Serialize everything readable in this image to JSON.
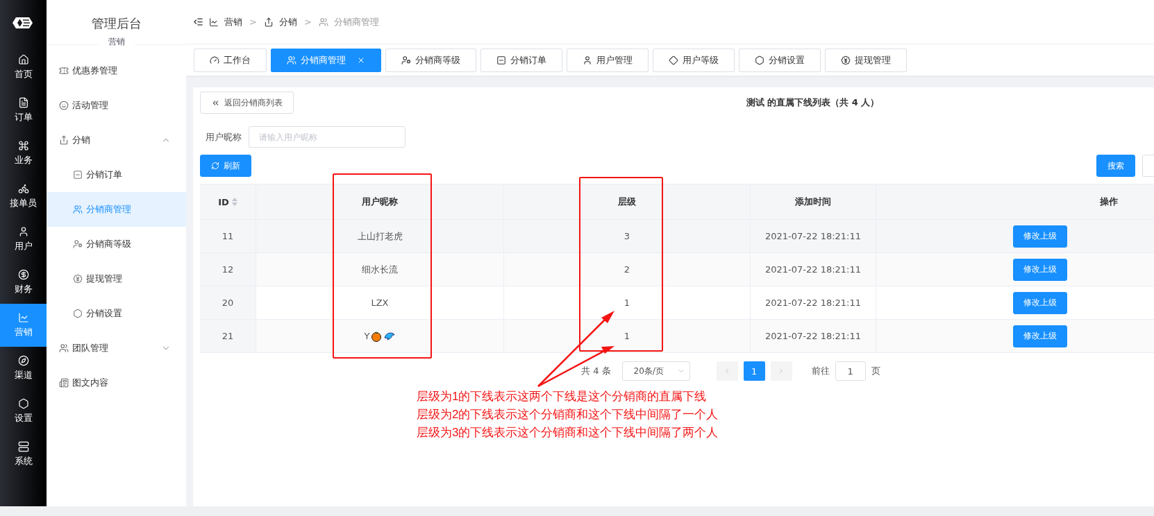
{
  "rail": {
    "items": [
      {
        "label": "首页",
        "selected": false
      },
      {
        "label": "订单",
        "selected": false
      },
      {
        "label": "业务",
        "selected": false
      },
      {
        "label": "接单员",
        "selected": false
      },
      {
        "label": "用户",
        "selected": false
      },
      {
        "label": "财务",
        "selected": false
      },
      {
        "label": "营销",
        "selected": true
      },
      {
        "label": "渠道",
        "selected": false
      },
      {
        "label": "设置",
        "selected": false
      },
      {
        "label": "系统",
        "selected": false
      }
    ]
  },
  "sidebar": {
    "title": "管理后台",
    "section": "营销",
    "items": [
      {
        "label": "优惠券管理",
        "selected": false
      },
      {
        "label": "活动管理",
        "selected": false
      },
      {
        "label": "分销",
        "selected": false,
        "expanded": true,
        "children": [
          {
            "label": "分销订单",
            "selected": false
          },
          {
            "label": "分销商管理",
            "selected": true
          },
          {
            "label": "分销商等级",
            "selected": false
          },
          {
            "label": "提现管理",
            "selected": false
          },
          {
            "label": "分销设置",
            "selected": false
          }
        ]
      },
      {
        "label": "团队管理",
        "selected": false,
        "expanded": false
      },
      {
        "label": "图文内容",
        "selected": false
      }
    ]
  },
  "breadcrumb": [
    "营销",
    "分销",
    "分销商管理"
  ],
  "breadcrumb_separator": ">",
  "tabs": [
    {
      "label": "工作台",
      "selected": false
    },
    {
      "label": "分销商管理",
      "selected": true,
      "closable": true
    },
    {
      "label": "分销商等级",
      "selected": false
    },
    {
      "label": "分销订单",
      "selected": false
    },
    {
      "label": "用户管理",
      "selected": false
    },
    {
      "label": "用户等级",
      "selected": false
    },
    {
      "label": "分销设置",
      "selected": false
    },
    {
      "label": "提现管理",
      "selected": false
    }
  ],
  "back_button": "返回分销商列表",
  "list_title": "测试 的直属下线列表（共 4 人）",
  "filter": {
    "label": "用户昵称",
    "placeholder": "请输入用户昵称"
  },
  "refresh_button": "刷新",
  "search_button": "搜索",
  "table": {
    "columns": [
      "ID",
      "用户昵称",
      "层级",
      "添加时间",
      "操作"
    ],
    "rows": [
      {
        "id": "11",
        "nickname": "上山打老虎",
        "has_icons": false,
        "level": "3",
        "time": "2021-07-22 18:21:11",
        "action": "修改上级"
      },
      {
        "id": "12",
        "nickname": "细水长流",
        "has_icons": false,
        "level": "2",
        "time": "2021-07-22 18:21:11",
        "action": "修改上级"
      },
      {
        "id": "20",
        "nickname": "LZX",
        "has_icons": false,
        "level": "1",
        "time": "2021-07-22 18:21:11",
        "action": "修改上级"
      },
      {
        "id": "21",
        "nickname": "Y",
        "has_icons": true,
        "level": "1",
        "time": "2021-07-22 18:21:11",
        "action": "修改上级"
      }
    ]
  },
  "pagination": {
    "total": "共 4 条",
    "page_size": "20条/页",
    "pages": [
      {
        "label": "1",
        "selected": true
      }
    ],
    "goto_label": "前往",
    "goto_value": "1",
    "goto_suffix": "页"
  },
  "annotation": {
    "lines": [
      "层级为1的下线表示这两个下线是这个分销商的直属下线",
      "层级为2的下线表示这个分销商和这个下线中间隔了一个人",
      "层级为3的下线表示这个分销商和这个下线中间隔了两个人"
    ]
  }
}
